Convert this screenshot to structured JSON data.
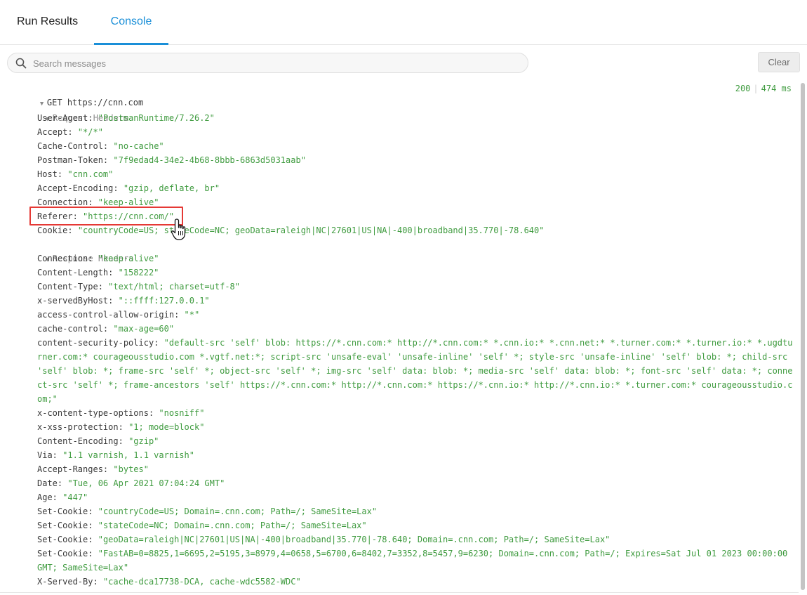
{
  "tabs": {
    "run_results": "Run Results",
    "console": "Console"
  },
  "search": {
    "placeholder": "Search messages",
    "value": ""
  },
  "toolbar": {
    "clear_label": "Clear"
  },
  "request": {
    "method": "GET",
    "url": "https://cnn.com",
    "status": "200",
    "time": "474 ms",
    "request_headers_label": "Request Headers",
    "response_headers_label": "Response Headers",
    "request_headers": [
      {
        "name": "User-Agent:",
        "value": "\"PostmanRuntime/7.26.2\""
      },
      {
        "name": "Accept:",
        "value": "\"*/*\""
      },
      {
        "name": "Cache-Control:",
        "value": "\"no-cache\""
      },
      {
        "name": "Postman-Token:",
        "value": "\"7f9edad4-34e2-4b68-8bbb-6863d5031aab\""
      },
      {
        "name": "Host:",
        "value": "\"cnn.com\""
      },
      {
        "name": "Accept-Encoding:",
        "value": "\"gzip, deflate, br\""
      },
      {
        "name": "Connection:",
        "value": "\"keep-alive\""
      },
      {
        "name": "Referer:",
        "value": "\"https://cnn.com/\""
      },
      {
        "name": "Cookie:",
        "value": "\"countryCode=US; stateCode=NC; geoData=raleigh|NC|27601|US|NA|-400|broadband|35.770|-78.640\""
      }
    ],
    "response_headers": [
      {
        "name": "Connection:",
        "value": "\"keep-alive\""
      },
      {
        "name": "Content-Length:",
        "value": "\"158222\""
      },
      {
        "name": "Content-Type:",
        "value": "\"text/html; charset=utf-8\""
      },
      {
        "name": "x-servedByHost:",
        "value": "\"::ffff:127.0.0.1\""
      },
      {
        "name": "access-control-allow-origin:",
        "value": "\"*\""
      },
      {
        "name": "cache-control:",
        "value": "\"max-age=60\""
      },
      {
        "name": "content-security-policy:",
        "value": "\"default-src 'self' blob: https://*.cnn.com:* http://*.cnn.com:* *.cnn.io:* *.cnn.net:* *.turner.com:* *.turner.io:* *.ugdtu",
        "cont": [
          "rner.com:* courageousstudio.com *.vgtf.net:*; script-src 'unsafe-eval' 'unsafe-inline' 'self' *; style-src 'unsafe-inline' 'self' blob: *; child-src",
          "'self' blob: *; frame-src 'self' *; object-src 'self' *; img-src 'self' data: blob: *; media-src 'self' data: blob: *; font-src 'self' data: *; conne",
          "ct-src 'self' *; frame-ancestors 'self' https://*.cnn.com:* http://*.cnn.com:* https://*.cnn.io:* http://*.cnn.io:* *.turner.com:* courageousstudio.c",
          "om;\""
        ]
      },
      {
        "name": "x-content-type-options:",
        "value": "\"nosniff\""
      },
      {
        "name": "x-xss-protection:",
        "value": "\"1; mode=block\""
      },
      {
        "name": "Content-Encoding:",
        "value": "\"gzip\""
      },
      {
        "name": "Via:",
        "value": "\"1.1 varnish, 1.1 varnish\""
      },
      {
        "name": "Accept-Ranges:",
        "value": "\"bytes\""
      },
      {
        "name": "Date:",
        "value": "\"Tue, 06 Apr 2021 07:04:24 GMT\""
      },
      {
        "name": "Age:",
        "value": "\"447\""
      },
      {
        "name": "Set-Cookie:",
        "value": "\"countryCode=US; Domain=.cnn.com; Path=/; SameSite=Lax\""
      },
      {
        "name": "Set-Cookie:",
        "value": "\"stateCode=NC; Domain=.cnn.com; Path=/; SameSite=Lax\""
      },
      {
        "name": "Set-Cookie:",
        "value": "\"geoData=raleigh|NC|27601|US|NA|-400|broadband|35.770|-78.640; Domain=.cnn.com; Path=/; SameSite=Lax\""
      },
      {
        "name": "Set-Cookie:",
        "value": "\"FastAB=0=8825,1=6695,2=5195,3=8979,4=0658,5=6700,6=8402,7=3352,8=5457,9=6230; Domain=.cnn.com; Path=/; Expires=Sat Jul 01 2023 00:00:00",
        "cont": [
          "GMT; SameSite=Lax\""
        ]
      },
      {
        "name": "X-Served-By:",
        "value": "\"cache-dca17738-DCA, cache-wdc5582-WDC\""
      }
    ]
  },
  "colors": {
    "accent": "#1a8fd8",
    "value_green": "#3f9b3f",
    "highlight_red": "#e53935"
  }
}
